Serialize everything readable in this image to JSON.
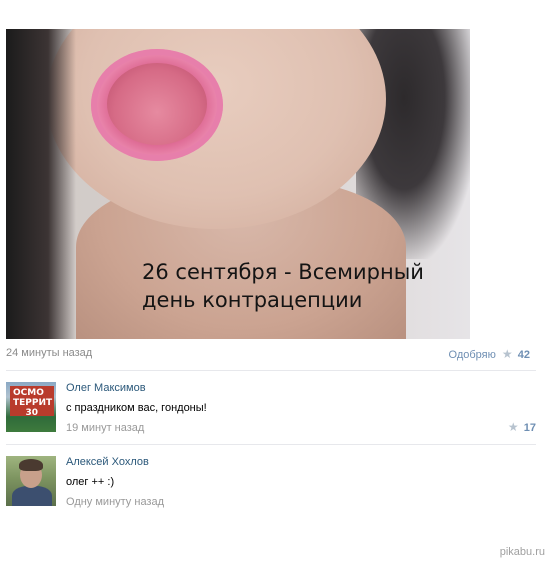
{
  "post": {
    "image_caption_line1": "26 сентября - Всемирный",
    "image_caption_line2": "день контрацепции",
    "time": "24 минуты назад",
    "like_label": "Одобряю",
    "like_count": "42",
    "like_icon": "star-icon"
  },
  "comments": [
    {
      "author": "Олег Максимов",
      "text": "с праздником вас, гондоны!",
      "time": "19 минут назад",
      "like_count": "17",
      "avatar_sign_text": "ОСМО\nТЕРРИТ\n30"
    },
    {
      "author": "Алексей Хохлов",
      "text": "олег ++ :)",
      "time": "Одну минуту назад"
    }
  ],
  "watermark": "pikabu.ru",
  "colors": {
    "link": "#2b587a",
    "like": "#6f8fb3",
    "muted": "#8a8a8a",
    "divider": "#e7e8ec"
  }
}
